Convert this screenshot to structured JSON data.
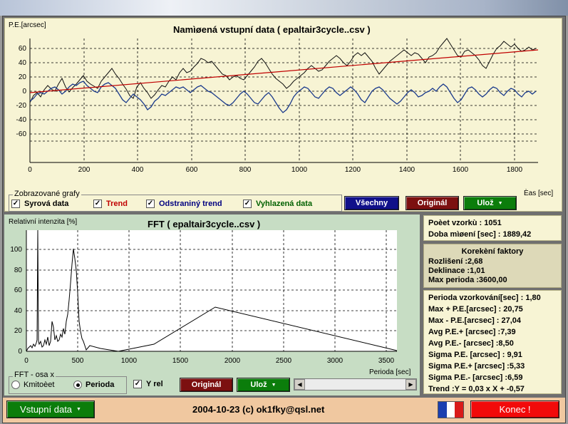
{
  "top_chart": {
    "title": "Namìøená vstupní data ( epaltair3cycle..csv )",
    "y_axis_name": "P.E.[arcsec]",
    "x_axis_name": "Èas [sec]",
    "x_ticks": [
      "0",
      "200",
      "400",
      "600",
      "800",
      "1000",
      "1200",
      "1400",
      "1600",
      "1800"
    ],
    "y_ticks": [
      "60",
      "40",
      "20",
      "0",
      "-20",
      "-40",
      "-60"
    ]
  },
  "graphs_group": {
    "legend": "Zobrazované grafy",
    "items": [
      {
        "label": "Syrová data",
        "checked": true,
        "color": "#000000"
      },
      {
        "label": "Trend",
        "checked": true,
        "color": "#c00000"
      },
      {
        "label": "Odstraniný trend",
        "checked": true,
        "color": "#000080"
      },
      {
        "label": "Vyhlazená data",
        "checked": true,
        "color": "#006000"
      }
    ],
    "check_mark": "✓"
  },
  "buttons": {
    "all": "Všechny",
    "original_top": "Originál",
    "save_top": "Ulož",
    "original_bottom": "Originál",
    "save_bottom": "Ulož",
    "input_data": "Vstupní data",
    "quit": "Konec !"
  },
  "fft_chart": {
    "title": "FFT ( epaltair3cycle..csv )",
    "y_axis_name": "Relativní intenzita [%]",
    "x_axis_name": "Perioda [sec]",
    "x_ticks": [
      "0",
      "500",
      "1000",
      "1500",
      "2000",
      "2500",
      "3000",
      "3500"
    ],
    "y_ticks": [
      "100",
      "80",
      "60",
      "40",
      "20",
      "0"
    ]
  },
  "fft_axis_group": {
    "legend": "FFT - osa x",
    "options": [
      {
        "label": "Kmitoèet",
        "selected": false
      },
      {
        "label": "Perioda",
        "selected": true
      }
    ]
  },
  "y_rel": {
    "label": "Y rel",
    "checked": true
  },
  "samples_box": {
    "lines": [
      "Poèet vzorkù : 1051",
      "Doba mìøení [sec] : 1889,42"
    ]
  },
  "correction_box": {
    "title": "Korekèní faktory",
    "lines": [
      "Rozlišení :2,68",
      "Deklinace :1,01",
      "Max perioda :3600,00"
    ]
  },
  "stats_box": {
    "lines": [
      "Perioda vzorkování[sec] : 1,80",
      "Max + P.E.[arcsec] : 20,75",
      "Max - P.E.[arcsec] : 27,04",
      "Avg P.E.+ [arcsec] :7,39",
      "Avg P.E.- [arcsec] :8,50",
      "Sigma P.E. [arcsec] : 9,91",
      "Sigma P.E.+ [arcsec] :5,33",
      "Sigma P.E.- [arcsec] :6,59",
      "Trend :Y = 0,03 x X + -0,57"
    ]
  },
  "status": {
    "text": "2004-10-23 (c) ok1fky@qsl.net"
  },
  "colors": {
    "yellow_panel": "#f7f4d4",
    "green_panel": "#c7ddc4",
    "raw_series": "#000000",
    "trend_series": "#c00000",
    "detrended_series": "#1a3a8c",
    "status_bar": "#f0c8a0"
  }
}
